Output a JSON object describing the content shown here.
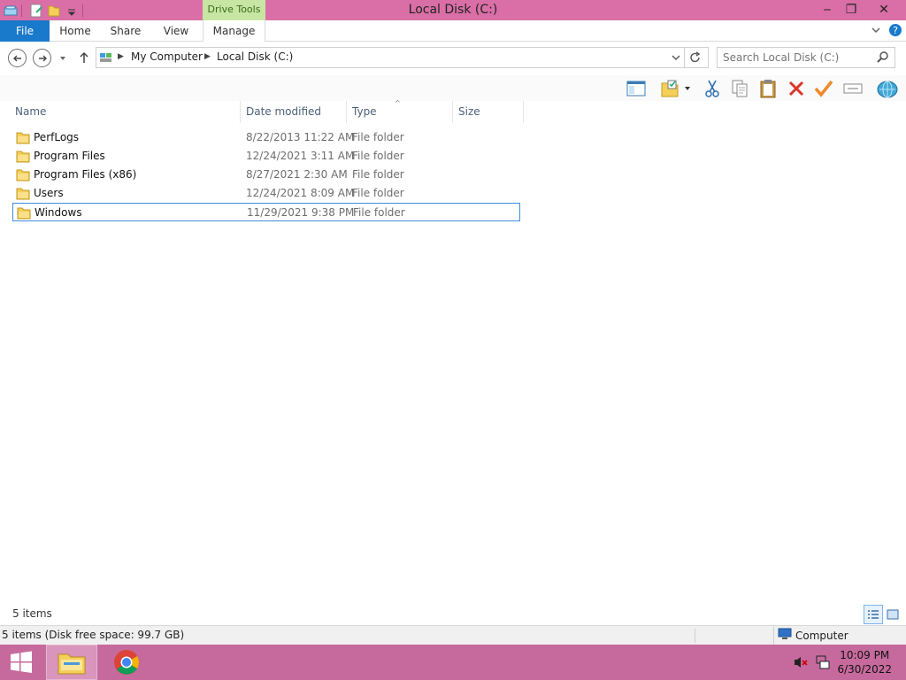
{
  "window": {
    "title": "Local Disk (C:)",
    "context_tab": "Drive Tools",
    "minimize": "‒",
    "restore": "❐",
    "close": "✕"
  },
  "ribbon": {
    "tabs": [
      "File",
      "Home",
      "Share",
      "View",
      "Manage"
    ]
  },
  "address": {
    "breadcrumb": [
      "My Computer",
      "Local Disk (C:)"
    ],
    "search_placeholder": "Search Local Disk (C:)"
  },
  "columns": {
    "name": "Name",
    "date": "Date modified",
    "type": "Type",
    "size": "Size"
  },
  "files": [
    {
      "name": "PerfLogs",
      "date": "8/22/2013 11:22 AM",
      "type": "File folder",
      "size": ""
    },
    {
      "name": "Program Files",
      "date": "12/24/2021 3:11 AM",
      "type": "File folder",
      "size": ""
    },
    {
      "name": "Program Files (x86)",
      "date": "8/27/2021 2:30 AM",
      "type": "File folder",
      "size": ""
    },
    {
      "name": "Users",
      "date": "12/24/2021 8:09 AM",
      "type": "File folder",
      "size": ""
    },
    {
      "name": "Windows",
      "date": "11/29/2021 9:38 PM",
      "type": "File folder",
      "size": ""
    }
  ],
  "selected_file": "Windows",
  "items_count": "5 items",
  "status": {
    "left": "5 items (Disk free space: 99.7 GB)",
    "right": "Computer"
  },
  "taskbar": {
    "time": "10:09 PM",
    "date": "6/30/2022"
  },
  "colors": {
    "title_bar": "#d96fa6",
    "taskbar": "#c66a9d",
    "file_tab": "#1979ca",
    "context_tab": "#c7e6a3",
    "selection_border": "#3c8ee0"
  }
}
